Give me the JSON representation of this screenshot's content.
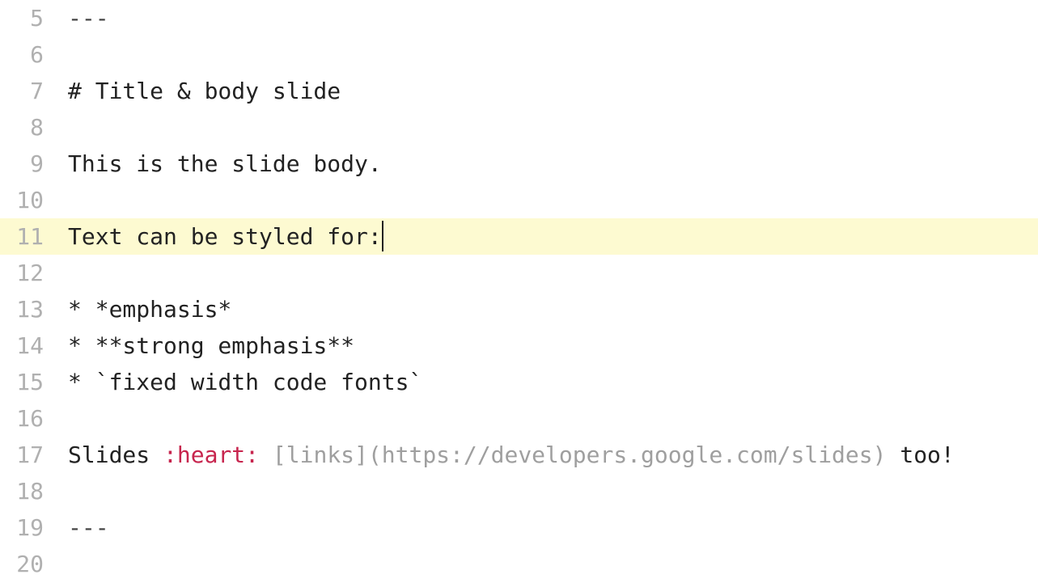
{
  "editor": {
    "activeLineIndex": 6,
    "lines": [
      {
        "num": "5",
        "tokens": [
          {
            "cls": "tok-meta",
            "t": "---"
          }
        ]
      },
      {
        "num": "6",
        "tokens": []
      },
      {
        "num": "7",
        "tokens": [
          {
            "cls": "tok-header",
            "t": "# Title & body slide"
          }
        ]
      },
      {
        "num": "8",
        "tokens": []
      },
      {
        "num": "9",
        "tokens": [
          {
            "cls": "tok-text",
            "t": "This is the slide body."
          }
        ]
      },
      {
        "num": "10",
        "tokens": []
      },
      {
        "num": "11",
        "tokens": [
          {
            "cls": "tok-text",
            "t": "Text can be styled for:"
          }
        ],
        "cursor": true
      },
      {
        "num": "12",
        "tokens": []
      },
      {
        "num": "13",
        "tokens": [
          {
            "cls": "tok-text",
            "t": "* *emphasis*"
          }
        ]
      },
      {
        "num": "14",
        "tokens": [
          {
            "cls": "tok-text",
            "t": "* **strong emphasis**"
          }
        ]
      },
      {
        "num": "15",
        "tokens": [
          {
            "cls": "tok-text",
            "t": "* `fixed width code fonts`"
          }
        ]
      },
      {
        "num": "16",
        "tokens": []
      },
      {
        "num": "17",
        "tokens": [
          {
            "cls": "tok-text",
            "t": "Slides "
          },
          {
            "cls": "tok-emoji",
            "t": ":heart:"
          },
          {
            "cls": "tok-text",
            "t": " "
          },
          {
            "cls": "tok-link",
            "t": "[links](https://developers.google.com/slides)"
          },
          {
            "cls": "tok-text",
            "t": " too!"
          }
        ]
      },
      {
        "num": "18",
        "tokens": []
      },
      {
        "num": "19",
        "tokens": [
          {
            "cls": "tok-meta",
            "t": "---"
          }
        ]
      },
      {
        "num": "20",
        "tokens": []
      }
    ]
  }
}
